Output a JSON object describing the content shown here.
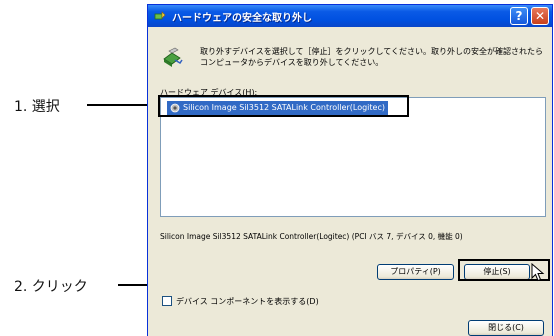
{
  "window": {
    "title": "ハードウェアの安全な取り外し",
    "help_glyph": "?",
    "close_glyph": "✕",
    "description": "取り外すデバイスを選択して［停止］をクリックしてください。取り外しの安全が確認されたらコンピュータからデバイスを取り外してください。",
    "hardware_label": "ハードウェア デバイス(H):",
    "devices": [
      {
        "label": "Silicon Image Sil3512 SATALink Controller(Logitec)",
        "selected": true
      }
    ],
    "status_text": "Silicon Image Sil3512 SATALink Controller(Logitec)  (PCI バス 7, デバイス 0, 機能 0)",
    "properties_button": "プロパティ(P)",
    "stop_button": "停止(S)",
    "show_components_label": "デバイス コンポーネントを表示する(D)",
    "show_components_checked": false,
    "close_button": "閉じる(C)"
  },
  "annotations": {
    "step1": "1. 選択",
    "step2": "2. クリック"
  },
  "colors": {
    "titlebar": "#0a5ae6",
    "selection": "#316ac5",
    "dialog_bg": "#ece9d8"
  }
}
